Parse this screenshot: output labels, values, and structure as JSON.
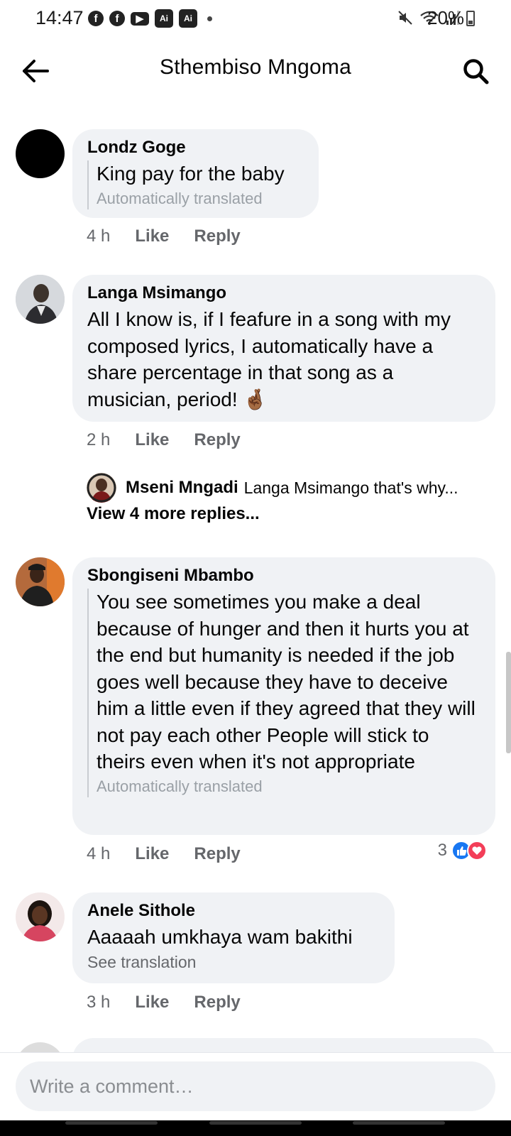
{
  "status": {
    "time": "14:47",
    "battery": "20%",
    "ai_label": "Ai"
  },
  "header": {
    "title": "Sthembiso Mngoma"
  },
  "comments": [
    {
      "author": "Londz Goge",
      "text": "King pay for the baby",
      "translated": "Automatically translated",
      "time": "4 h",
      "like": "Like",
      "reply": "Reply"
    },
    {
      "author": "Langa Msimango",
      "text": "All I know is, if I feafure in a song with my composed lyrics, I automatically have a share percentage in that song as a musician, period! 🤞🏾",
      "time": "2 h",
      "like": "Like",
      "reply": "Reply",
      "reply_preview": {
        "author": "Mseni Mngadi",
        "snippet": "Langa Msimango that's why..."
      },
      "view_more": "View 4 more replies..."
    },
    {
      "author": "Sbongiseni Mbambo",
      "text": "You see sometimes you make a deal because of hunger and then it hurts you at the end but humanity is needed if the job goes well because they have to deceive him a little even if they agreed that they will not pay each other People will stick to theirs even when it's not appropriate",
      "translated": "Automatically translated",
      "time": "4 h",
      "like": "Like",
      "reply": "Reply",
      "reactions": "3"
    },
    {
      "author": "Anele Sithole",
      "text": "Aaaaah umkhaya wam bakithi",
      "see_translation": "See translation",
      "time": "3 h",
      "like": "Like",
      "reply": "Reply"
    }
  ],
  "composer": {
    "placeholder": "Write a comment…"
  },
  "colors": {
    "bubble": "#f0f2f5",
    "like_blue": "#1877f2",
    "love_red": "#f33e58",
    "muted": "#65676b"
  },
  "icons": [
    "back-arrow-icon",
    "search-icon",
    "facebook-icon",
    "youtube-icon",
    "ai-icon",
    "mute-icon",
    "wifi-icon",
    "signal-icon",
    "battery-icon",
    "like-reaction-icon",
    "love-reaction-icon"
  ]
}
